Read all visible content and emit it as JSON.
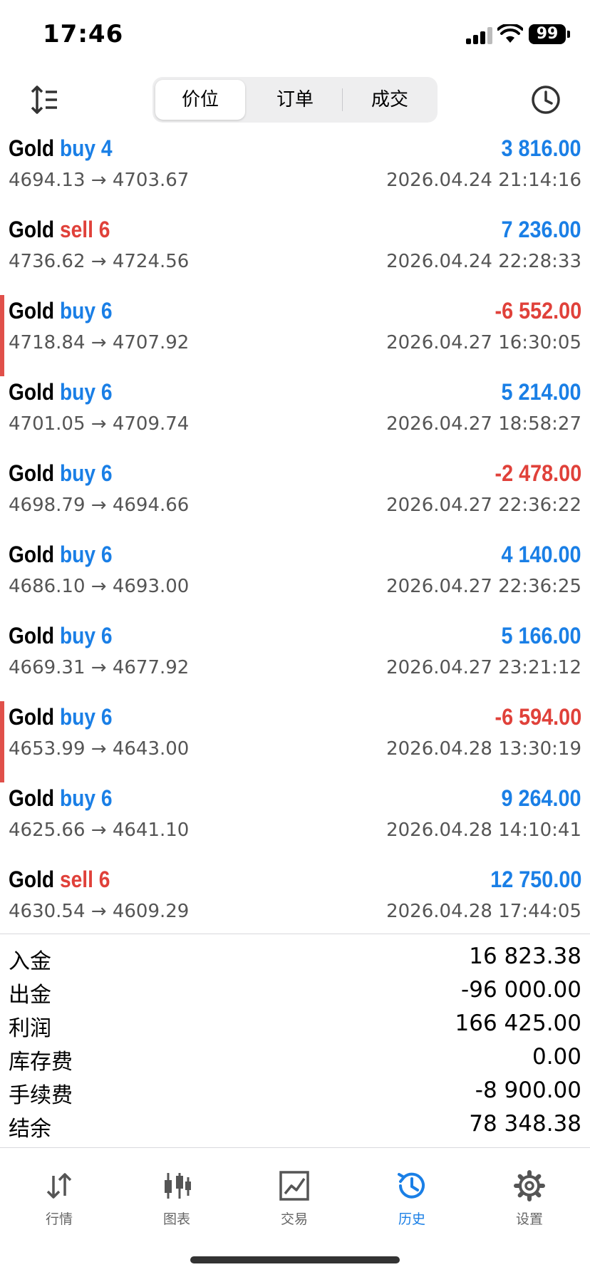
{
  "status_bar": {
    "time": "17:46",
    "battery": "99"
  },
  "toolbar": {
    "tabs": [
      {
        "label": "价位"
      },
      {
        "label": "订单"
      },
      {
        "label": "成交"
      }
    ],
    "active_tab": 0
  },
  "deals": [
    {
      "symbol": "Gold",
      "side": "buy 4",
      "type": "buy",
      "profit": "3 816.00",
      "negative": false,
      "prices": "4694.13 → 4703.67",
      "time": "2026.04.24 21:14:16",
      "marked": false
    },
    {
      "symbol": "Gold",
      "side": "sell 6",
      "type": "sell",
      "profit": "7 236.00",
      "negative": false,
      "prices": "4736.62 → 4724.56",
      "time": "2026.04.24 22:28:33",
      "marked": false
    },
    {
      "symbol": "Gold",
      "side": "buy 6",
      "type": "buy",
      "profit": "-6 552.00",
      "negative": true,
      "prices": "4718.84 → 4707.92",
      "time": "2026.04.27 16:30:05",
      "marked": true
    },
    {
      "symbol": "Gold",
      "side": "buy 6",
      "type": "buy",
      "profit": "5 214.00",
      "negative": false,
      "prices": "4701.05 → 4709.74",
      "time": "2026.04.27 18:58:27",
      "marked": false
    },
    {
      "symbol": "Gold",
      "side": "buy 6",
      "type": "buy",
      "profit": "-2 478.00",
      "negative": true,
      "prices": "4698.79 → 4694.66",
      "time": "2026.04.27 22:36:22",
      "marked": false
    },
    {
      "symbol": "Gold",
      "side": "buy 6",
      "type": "buy",
      "profit": "4 140.00",
      "negative": false,
      "prices": "4686.10 → 4693.00",
      "time": "2026.04.27 22:36:25",
      "marked": false
    },
    {
      "symbol": "Gold",
      "side": "buy 6",
      "type": "buy",
      "profit": "5 166.00",
      "negative": false,
      "prices": "4669.31 → 4677.92",
      "time": "2026.04.27 23:21:12",
      "marked": false
    },
    {
      "symbol": "Gold",
      "side": "buy 6",
      "type": "buy",
      "profit": "-6 594.00",
      "negative": true,
      "prices": "4653.99 → 4643.00",
      "time": "2026.04.28 13:30:19",
      "marked": true
    },
    {
      "symbol": "Gold",
      "side": "buy 6",
      "type": "buy",
      "profit": "9 264.00",
      "negative": false,
      "prices": "4625.66 → 4641.10",
      "time": "2026.04.28 14:10:41",
      "marked": false
    },
    {
      "symbol": "Gold",
      "side": "sell 6",
      "type": "sell",
      "profit": "12 750.00",
      "negative": false,
      "prices": "4630.54 → 4609.29",
      "time": "2026.04.28 17:44:05",
      "marked": false
    }
  ],
  "summary": [
    {
      "label": "入金",
      "value": "16 823.38"
    },
    {
      "label": "出金",
      "value": "-96 000.00"
    },
    {
      "label": "利润",
      "value": "166 425.00"
    },
    {
      "label": "库存费",
      "value": "0.00"
    },
    {
      "label": "手续费",
      "value": "-8 900.00"
    },
    {
      "label": "结余",
      "value": "78 348.38"
    }
  ],
  "tabbar": [
    {
      "label": "行情",
      "icon": "quotes-arrows-icon"
    },
    {
      "label": "图表",
      "icon": "candlestick-chart-icon"
    },
    {
      "label": "交易",
      "icon": "trade-chart-icon"
    },
    {
      "label": "历史",
      "icon": "history-clock-icon"
    },
    {
      "label": "设置",
      "icon": "settings-gear-icon"
    }
  ],
  "active_tabbar": 3,
  "colors": {
    "accent": "#1a7fe6",
    "loss": "#e0413a",
    "marker": "#e0504a"
  }
}
